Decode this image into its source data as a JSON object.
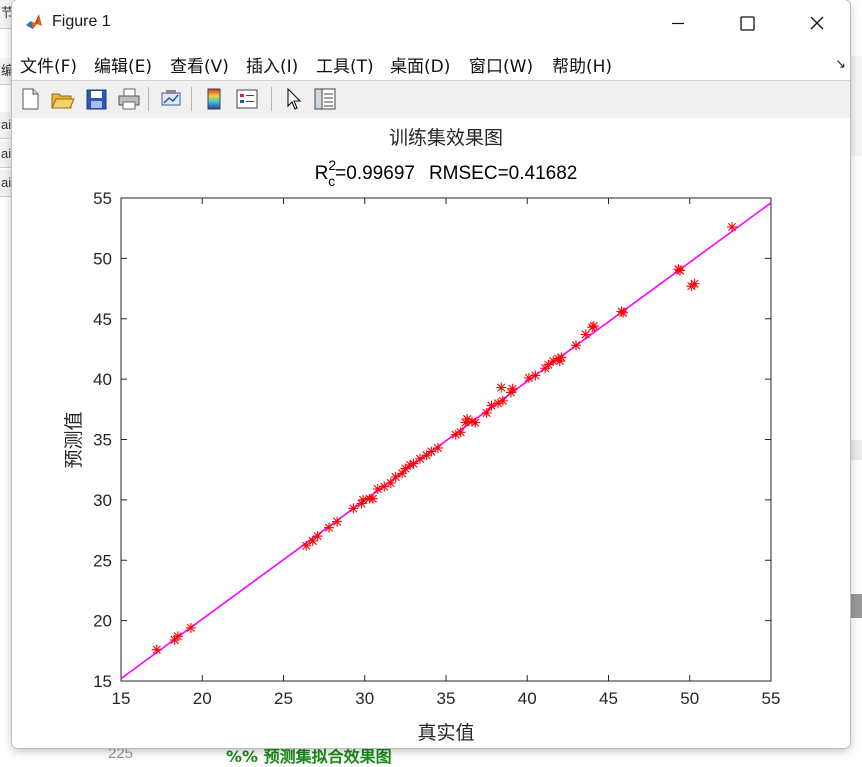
{
  "window": {
    "title": "Figure 1"
  },
  "menu": [
    "文件(F)",
    "编辑(E)",
    "查看(V)",
    "插入(I)",
    "工具(T)",
    "桌面(D)",
    "窗口(W)",
    "帮助(H)"
  ],
  "background": {
    "left_chars": [
      "节",
      "编",
      "ai",
      "ai",
      "ai"
    ],
    "line_number": "225",
    "code_line": "%% 预测集拟合效果图"
  },
  "colors": {
    "points": "#ff0000",
    "fit_line": "#ff00ff",
    "window_bg": "#ffffff",
    "toolbar_bg": "#f0f0f0"
  },
  "icons": [
    "new-file-icon",
    "open-folder-icon",
    "save-icon",
    "print-icon",
    "link-plot-icon",
    "colorbar-icon",
    "legend-icon",
    "cursor-icon",
    "property-inspector-icon"
  ],
  "chart_data": {
    "type": "scatter",
    "title": "训练集效果图",
    "subtitle": {
      "r_base": "R",
      "r_sub": "c",
      "r_sup": "2",
      "r_value": "=0.99697",
      "rmsec": "RMSEC=0.41682"
    },
    "xlabel": "真实值",
    "ylabel": "预测值",
    "xlim": [
      15,
      55
    ],
    "ylim": [
      15,
      55
    ],
    "xticks": [
      15,
      20,
      25,
      30,
      35,
      40,
      45,
      50,
      55
    ],
    "yticks": [
      15,
      20,
      25,
      30,
      35,
      40,
      45,
      50,
      55
    ],
    "grid": false,
    "marker": "asterisk",
    "fit_line": {
      "from": [
        15,
        15.2
      ],
      "to": [
        55,
        54.6
      ]
    },
    "points": [
      [
        17.2,
        17.6
      ],
      [
        18.3,
        18.4
      ],
      [
        18.5,
        18.7
      ],
      [
        19.3,
        19.4
      ],
      [
        26.4,
        26.2
      ],
      [
        26.8,
        26.6
      ],
      [
        27.1,
        27.0
      ],
      [
        27.8,
        27.7
      ],
      [
        28.3,
        28.2
      ],
      [
        29.3,
        29.3
      ],
      [
        29.8,
        29.7
      ],
      [
        29.9,
        30.0
      ],
      [
        30.3,
        30.1
      ],
      [
        30.5,
        30.1
      ],
      [
        30.8,
        30.9
      ],
      [
        31.2,
        31.1
      ],
      [
        31.6,
        31.4
      ],
      [
        31.9,
        31.9
      ],
      [
        32.3,
        32.2
      ],
      [
        32.5,
        32.6
      ],
      [
        32.8,
        32.9
      ],
      [
        33.0,
        33.0
      ],
      [
        33.4,
        33.4
      ],
      [
        33.8,
        33.7
      ],
      [
        34.1,
        34.0
      ],
      [
        34.5,
        34.3
      ],
      [
        35.6,
        35.4
      ],
      [
        35.9,
        35.6
      ],
      [
        36.2,
        36.4
      ],
      [
        36.3,
        36.7
      ],
      [
        36.6,
        36.5
      ],
      [
        36.8,
        36.4
      ],
      [
        37.5,
        37.2
      ],
      [
        37.8,
        37.8
      ],
      [
        38.2,
        38.0
      ],
      [
        38.5,
        38.2
      ],
      [
        38.4,
        39.3
      ],
      [
        39.1,
        39.2
      ],
      [
        39.0,
        38.9
      ],
      [
        40.1,
        40.1
      ],
      [
        40.5,
        40.3
      ],
      [
        41.1,
        40.9
      ],
      [
        41.3,
        41.2
      ],
      [
        41.6,
        41.5
      ],
      [
        41.9,
        41.7
      ],
      [
        42.1,
        41.8
      ],
      [
        42.0,
        41.5
      ],
      [
        43.0,
        42.8
      ],
      [
        43.6,
        43.7
      ],
      [
        44.0,
        44.3
      ],
      [
        44.1,
        44.4
      ],
      [
        45.8,
        45.6
      ],
      [
        45.9,
        45.5
      ],
      [
        49.3,
        49.1
      ],
      [
        49.4,
        49.0
      ],
      [
        50.1,
        47.7
      ],
      [
        50.3,
        47.9
      ],
      [
        52.6,
        52.6
      ]
    ]
  }
}
